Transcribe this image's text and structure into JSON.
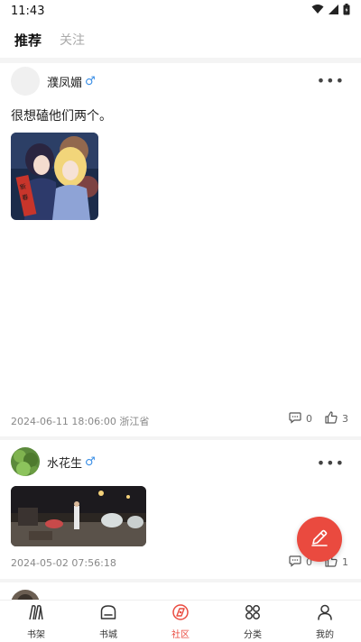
{
  "status_bar": {
    "time": "11:43",
    "icons": [
      "wifi-icon",
      "signal-icon",
      "battery-icon"
    ]
  },
  "tabs": [
    {
      "label": "推荐",
      "active": true
    },
    {
      "label": "关注",
      "active": false
    }
  ],
  "posts": [
    {
      "username": "濮凤媚",
      "gender_symbol": "♂",
      "text": "很想磕他们两个。",
      "meta": "2024-06-11 18:06:00 浙江省",
      "comments": "0",
      "likes": "3"
    },
    {
      "username": "水花生",
      "gender_symbol": "♂",
      "text": "",
      "meta": "2024-05-02 07:56:18",
      "comments": "0",
      "likes": "1"
    }
  ],
  "bottom_nav": [
    {
      "label": "书架",
      "icon": "bookshelf-icon",
      "active": false
    },
    {
      "label": "书城",
      "icon": "bookstore-icon",
      "active": false
    },
    {
      "label": "社区",
      "icon": "community-icon",
      "active": true
    },
    {
      "label": "分类",
      "icon": "category-icon",
      "active": false
    },
    {
      "label": "我的",
      "icon": "profile-icon",
      "active": false
    }
  ],
  "colors": {
    "accent": "#ea4a3f",
    "gender_male": "#3a8ee6",
    "meta_text": "#888888"
  }
}
